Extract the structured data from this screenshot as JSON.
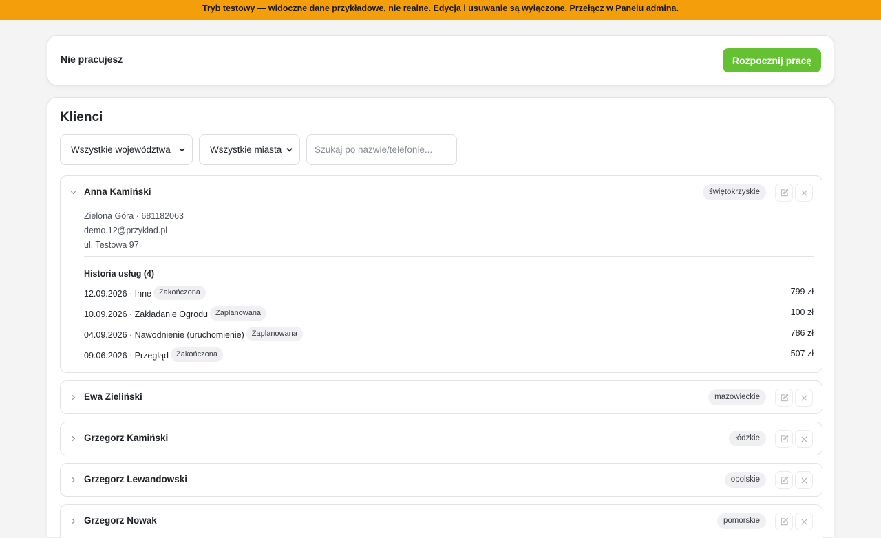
{
  "banner": {
    "text": "Tryb testowy — widoczne dane przykładowe, nie realne. Edycja i usuwanie są wyłączone. Przełącz w Panelu admina."
  },
  "work": {
    "status": "Nie pracujesz",
    "start_label": "Rozpocznij pracę"
  },
  "clients": {
    "title": "Klienci",
    "filters": {
      "region": "Wszystkie województwa",
      "city": "Wszystkie miasta",
      "search_placeholder": "Szukaj po nazwie/telefonie..."
    },
    "items": [
      {
        "name": "Anna Kamiński",
        "region": "świętokrzyskie",
        "expanded": true,
        "city_phone": "Zielona Góra · 681182063",
        "email": "demo.12@przyklad.pl",
        "address": "ul. Testowa 97",
        "history_title": "Historia usług (4)",
        "services": [
          {
            "desc": "12.09.2026 · Inne",
            "status": "Zakończona",
            "price": "799 zł"
          },
          {
            "desc": "10.09.2026 · Zakładanie Ogrodu",
            "status": "Zaplanowana",
            "price": "100 zł"
          },
          {
            "desc": "04.09.2026 · Nawodnienie (uruchomienie)",
            "status": "Zaplanowana",
            "price": "786 zł"
          },
          {
            "desc": "09.06.2026 · Przegląd",
            "status": "Zakończona",
            "price": "507 zł"
          }
        ]
      },
      {
        "name": "Ewa Zieliński",
        "region": "mazowieckie",
        "expanded": false
      },
      {
        "name": "Grzegorz Kamiński",
        "region": "łódzkie",
        "expanded": false
      },
      {
        "name": "Grzegorz Lewandowski",
        "region": "opolskie",
        "expanded": false
      },
      {
        "name": "Grzegorz Nowak",
        "region": "pomorskie",
        "expanded": false
      }
    ]
  },
  "icons": {
    "select_chevron": "chevron-down-icon",
    "expanded_chevron": "chevron-down-icon",
    "collapsed_chevron": "chevron-right-icon",
    "edit": "edit-icon",
    "delete": "close-icon"
  },
  "colors": {
    "banner": "#f59e0b",
    "start_button": "#63c132",
    "badge_bg": "#f0f0f2"
  }
}
